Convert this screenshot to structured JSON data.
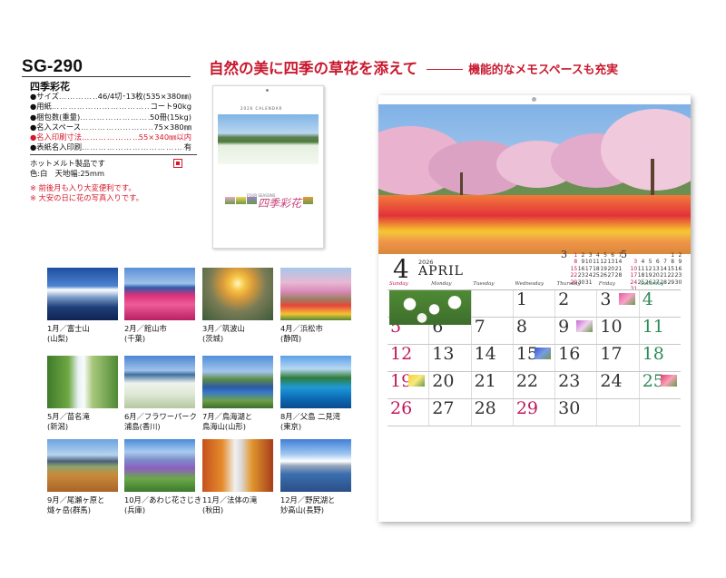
{
  "product": {
    "model": "SG-290",
    "name": "四季彩花",
    "specs": [
      {
        "key": "●サイズ",
        "value": "46/4切･13枚(535×380㎜)",
        "red": false
      },
      {
        "key": "●用紙",
        "value": "コート90kg",
        "red": false
      },
      {
        "key": "●梱包数(重量)",
        "value": "50冊(15kg)",
        "red": false
      },
      {
        "key": "●名入スペース",
        "value": "75×380㎜",
        "red": false
      },
      {
        "key": "●名入印刷寸法",
        "value": "55×340㎜以内",
        "red": true
      },
      {
        "key": "●表紙名入印刷",
        "value": "有",
        "red": false
      }
    ],
    "notes": {
      "hotmelt": "ホットメルト製品です",
      "color": "色:白　天地幅:25mm",
      "extra1": "※ 前後月も入り大変便利です。",
      "extra2": "※ 大安の日に花の写真入りです。"
    },
    "hot_badge_icon": "red-square-badge"
  },
  "headline": {
    "main": "自然の美に四季の草花を添えて",
    "sub": "機能的なメモスペースも充実",
    "color": "#c8192e"
  },
  "cover": {
    "calendar_label": "2026 CALENDAR",
    "season_label": "FOUR SEASONS",
    "title": "四季彩花"
  },
  "months": [
    {
      "month": "1月／富士山",
      "place": "(山梨)"
    },
    {
      "month": "2月／館山市",
      "place": "(千葉)"
    },
    {
      "month": "3月／筑波山",
      "place": "(茨城)"
    },
    {
      "month": "4月／浜松市",
      "place": "(静岡)"
    },
    {
      "month": "5月／苗名滝",
      "place": "(新潟)"
    },
    {
      "month": "6月／フラワーパーク",
      "place": "浦島(香川)"
    },
    {
      "month": "7月／鳥海湖と",
      "place": "鳥海山(山形)"
    },
    {
      "month": "8月／父島 二見湾",
      "place": "(東京)"
    },
    {
      "month": "9月／尾瀬ヶ原と",
      "place": "燧ヶ岳(群馬)"
    },
    {
      "month": "10月／あわじ花さじき",
      "place": "(兵庫)"
    },
    {
      "month": "11月／法体の滝",
      "place": "(秋田)"
    },
    {
      "month": "12月／野尻湖と",
      "place": "妙高山(長野)"
    }
  ],
  "calendar": {
    "month_number": "4",
    "month_name": "APRIL",
    "year_label": "2026",
    "weekdays": [
      "Sunday",
      "Monday",
      "Tuesday",
      "Wednesday",
      "Thursday",
      "Friday",
      "Saturday"
    ],
    "prev_month": {
      "label": "3",
      "days": [
        "1",
        "2",
        "3",
        "4",
        "5",
        "6",
        "7",
        "8",
        "9",
        "10",
        "11",
        "12",
        "13",
        "14",
        "15",
        "16",
        "17",
        "18",
        "19",
        "20",
        "21",
        "22",
        "23",
        "24",
        "25",
        "26",
        "27",
        "28",
        "29",
        "30",
        "31"
      ]
    },
    "next_month": {
      "label": "5",
      "days": [
        "1",
        "2",
        "3",
        "4",
        "5",
        "6",
        "7",
        "8",
        "9",
        "10",
        "11",
        "12",
        "13",
        "14",
        "15",
        "16",
        "17",
        "18",
        "19",
        "20",
        "21",
        "22",
        "23",
        "24",
        "25",
        "26",
        "27",
        "28",
        "29",
        "30",
        "31"
      ]
    },
    "weeks": [
      [
        "",
        "",
        "",
        "1",
        "2",
        "3",
        "4"
      ],
      [
        "5",
        "6",
        "7",
        "8",
        "9",
        "10",
        "11"
      ],
      [
        "12",
        "13",
        "14",
        "15",
        "16",
        "17",
        "18"
      ],
      [
        "19",
        "20",
        "21",
        "22",
        "23",
        "24",
        "25"
      ],
      [
        "26",
        "27",
        "28",
        "29",
        "30",
        "",
        ""
      ]
    ]
  }
}
